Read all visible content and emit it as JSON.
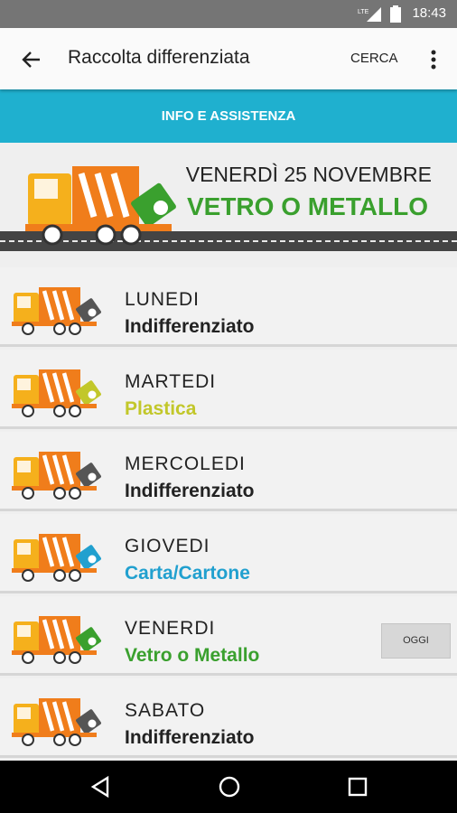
{
  "status_bar": {
    "network": "LTE",
    "time": "18:43"
  },
  "app_bar": {
    "title": "Raccolta differenziata",
    "search_label": "CERCA"
  },
  "info_banner": {
    "label": "INFO E ASSISTENZA"
  },
  "today": {
    "date": "VENERDÌ 25 NOVEMBRE",
    "waste_type": "VETRO O METALLO",
    "bin_color": "#3aa02e"
  },
  "schedule": [
    {
      "day": "LUNEDI",
      "waste": "Indifferenziato",
      "color": "#222222",
      "bin_color": "#555555"
    },
    {
      "day": "MARTEDI",
      "waste": "Plastica",
      "color": "#c2c72a",
      "bin_color": "#c2c72a"
    },
    {
      "day": "MERCOLEDI",
      "waste": "Indifferenziato",
      "color": "#222222",
      "bin_color": "#555555"
    },
    {
      "day": "GIOVEDI",
      "waste": "Carta/Cartone",
      "color": "#21a0cf",
      "bin_color": "#21a0cf"
    },
    {
      "day": "VENERDI",
      "waste": "Vetro o Metallo",
      "color": "#3aa02e",
      "bin_color": "#3aa02e",
      "today_label": "OGGI"
    },
    {
      "day": "SABATO",
      "waste": "Indifferenziato",
      "color": "#222222",
      "bin_color": "#555555"
    }
  ],
  "colors": {
    "accent": "#1fb0cf",
    "truck_orange": "#f07d1b",
    "cab_yellow": "#f5b01c"
  },
  "icons": [
    "back-arrow-icon",
    "more-vert-icon",
    "truck-icon",
    "bin-icon",
    "nav-back-icon",
    "nav-home-icon",
    "nav-recents-icon"
  ]
}
